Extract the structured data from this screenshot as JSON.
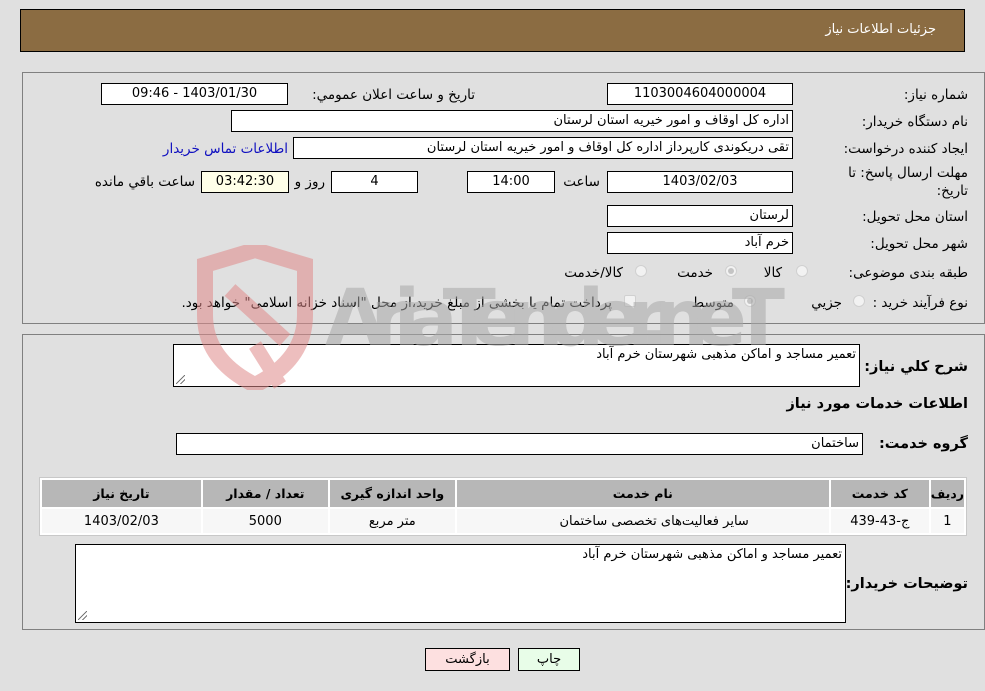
{
  "header": {
    "title": "جزئیات اطلاعات نیاز"
  },
  "form": {
    "need_number": {
      "label": "شماره نیاز:",
      "value": "1103004604000004"
    },
    "announce_datetime": {
      "label": "تاریخ و ساعت اعلان عمومي:",
      "value": "1403/01/30 - 09:46"
    },
    "buyer_org": {
      "label": "نام دستگاه خریدار:",
      "value": "اداره کل اوقاف و امور خيريه استان لرستان"
    },
    "requester": {
      "label": "ایجاد کننده درخواست:",
      "value": "تقی دریکوندی کارپرداز اداره کل اوقاف و امور خيريه استان لرستان",
      "contact_link": "اطلاعات تماس خریدار"
    },
    "deadline": {
      "label_line1": "مهلت ارسال پاسخ: تا",
      "label_line2": "تاریخ:",
      "date": "1403/02/03",
      "time_label": "ساعت",
      "time": "14:00",
      "days": "4",
      "days_label": "روز و",
      "remaining": "03:42:30",
      "remaining_label": "ساعت باقي مانده"
    },
    "province": {
      "label": "استان محل تحویل:",
      "value": "لرستان"
    },
    "city": {
      "label": "شهر محل تحویل:",
      "value": "خرم آباد"
    },
    "category": {
      "label": "طبقه بندی موضوعی:",
      "options": [
        {
          "label": "کالا",
          "selected": false
        },
        {
          "label": "خدمت",
          "selected": true
        },
        {
          "label": "کالا/خدمت",
          "selected": false
        }
      ]
    },
    "purchase_type": {
      "label": "نوع فرآیند خرید :",
      "options": [
        {
          "label": "جزيي",
          "selected": false
        },
        {
          "label": "متوسط",
          "selected": true
        }
      ],
      "treasury_checkbox": {
        "label": "پرداخت تمام يا بخشی از مبلغ خرید،از محل \"اسناد خزانه اسلامی\" خواهد بود.",
        "checked": false
      }
    }
  },
  "details": {
    "summary_label": "شرح كلي نياز:",
    "summary_value": "تعمیر مساجد و اماکن مذهبی شهرستان خرم آباد",
    "services_heading": "اطلاعات خدمات مورد نياز",
    "service_group_label": "گروه خدمت:",
    "service_group_value": "ساختمان",
    "table": {
      "headers": [
        "رديف",
        "کد خدمت",
        "نام خدمت",
        "واحد اندازه گيری",
        "تعداد / مقدار",
        "تاریخ نیاز"
      ],
      "rows": [
        [
          "1",
          "ج-43-439",
          "سایر فعالیت‌های تخصصی ساختمان",
          "متر مربع",
          "5000",
          "1403/02/03"
        ]
      ]
    },
    "buyer_notes_label": "توضيحات خريدار:",
    "buyer_notes_value": "تعمیر مساجد و اماکن مذهبی شهرستان خرم آباد"
  },
  "buttons": {
    "print": "چاپ",
    "back": "بازگشت"
  },
  "watermark": {
    "text": "AriaTender.neT"
  }
}
